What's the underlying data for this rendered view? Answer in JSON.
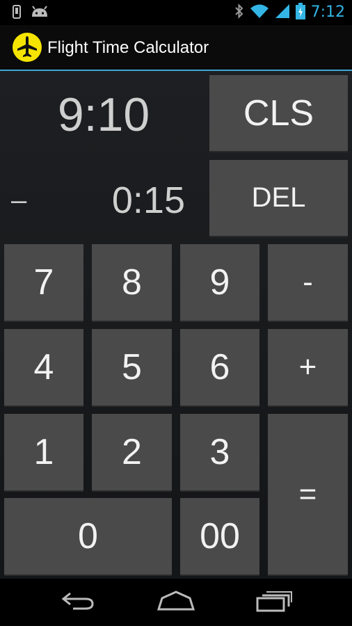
{
  "status_bar": {
    "time": "7:12",
    "icons": [
      "phone-icon",
      "android-icon",
      "bluetooth-icon",
      "wifi-icon",
      "signal-icon",
      "battery-icon"
    ]
  },
  "action_bar": {
    "title": "Flight Time Calculator",
    "icon": "airplane-icon",
    "icon_color": "#f5e400",
    "divider_color": "#3fa7d6"
  },
  "display": {
    "main_value": "9:10",
    "operator": "–",
    "sub_value": "0:15"
  },
  "keys": {
    "cls": "CLS",
    "del": "DEL",
    "seven": "7",
    "eight": "8",
    "nine": "9",
    "minus": "-",
    "four": "4",
    "five": "5",
    "six": "6",
    "plus": "+",
    "one": "1",
    "two": "2",
    "three": "3",
    "equals": "=",
    "zero": "0",
    "double_zero": "00"
  },
  "nav_bar": {
    "icons": [
      "back-icon",
      "home-icon",
      "recent-apps-icon"
    ]
  }
}
